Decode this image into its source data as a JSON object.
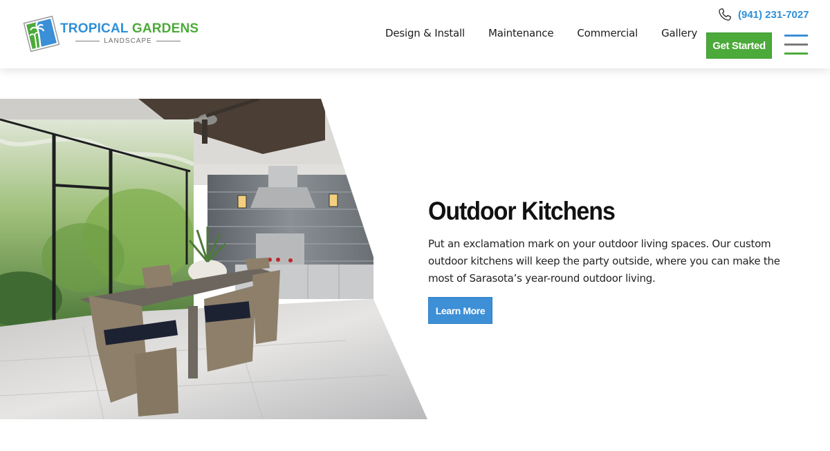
{
  "header": {
    "logo": {
      "word1": "TROPICAL",
      "word2": "GARDENS",
      "subtitle": "LANDSCAPE"
    },
    "nav": [
      {
        "label": "Design & Install"
      },
      {
        "label": "Maintenance"
      },
      {
        "label": "Commercial"
      },
      {
        "label": "Gallery"
      }
    ],
    "phone": {
      "icon": "phone-icon",
      "number": "(941) 231-7027"
    },
    "cta_label": "Get Started",
    "menu_icon": "hamburger-menu-icon"
  },
  "feature": {
    "image_alt": "Outdoor kitchen with dining table, wicker chairs, stainless grill and range hood",
    "title": "Outdoor Kitchens",
    "body": "Put an exclamation mark on your outdoor living spaces. Our custom outdoor kitchens will keep the party outside, where you can make the most of Sarasota’s year-round outdoor living.",
    "button_label": "Learn More"
  },
  "colors": {
    "brand_blue": "#2f8fd8",
    "brand_green": "#4caa3a",
    "button_blue": "#3d8fd6",
    "menu_gray": "#7a7a7a"
  }
}
